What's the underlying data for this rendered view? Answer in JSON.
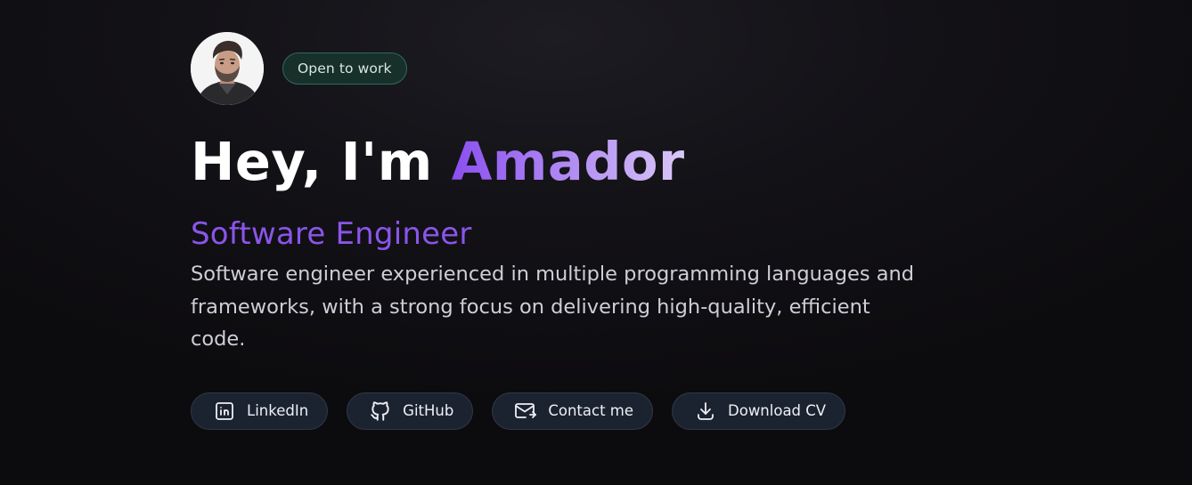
{
  "profile": {
    "avatar_alt": "Profile photo",
    "status_badge": "Open to work"
  },
  "hero": {
    "greeting": "Hey, I'm",
    "name": "Amador",
    "role": "Software Engineer",
    "bio": "Software engineer experienced in multiple programming languages and frameworks, with a strong focus on delivering high-quality, efficient code."
  },
  "actions": [
    {
      "label": "LinkedIn",
      "icon": "linkedin-icon"
    },
    {
      "label": "GitHub",
      "icon": "github-icon"
    },
    {
      "label": "Contact me",
      "icon": "mail-icon"
    },
    {
      "label": "Download CV",
      "icon": "download-icon"
    }
  ],
  "colors": {
    "accent": "#8b55ea",
    "badge_border": "#2f6b5f",
    "button_bg": "#1b2330"
  }
}
